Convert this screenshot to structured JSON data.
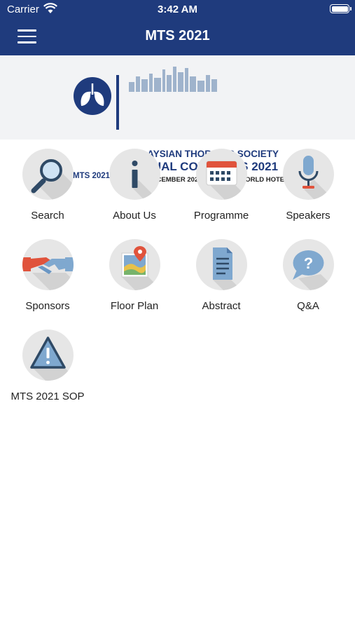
{
  "status_bar": {
    "carrier": "Carrier",
    "time": "3:42 AM"
  },
  "nav": {
    "title": "MTS 2021"
  },
  "banner": {
    "logo_text": "MTS 2021",
    "line1": "MALAYSIAN THORACIC SOCIETY",
    "line2": "ANNUAL CONGRESS 2021",
    "dates": "2-5 DECEMBER 2021",
    "venue": "ONE WORLD HOTEL"
  },
  "menu": [
    {
      "label": "Search",
      "icon": "search-icon"
    },
    {
      "label": "About Us",
      "icon": "info-icon"
    },
    {
      "label": "Programme",
      "icon": "calendar-icon"
    },
    {
      "label": "Speakers",
      "icon": "microphone-icon"
    },
    {
      "label": "Sponsors",
      "icon": "handshake-icon"
    },
    {
      "label": "Floor Plan",
      "icon": "map-pin-icon"
    },
    {
      "label": "Abstract",
      "icon": "document-icon"
    },
    {
      "label": "Q&A",
      "icon": "question-bubble-icon"
    },
    {
      "label": "MTS 2021 SOP",
      "icon": "warning-icon"
    }
  ],
  "colors": {
    "nav_bg": "#1f3b7d",
    "brand_blue": "#1f3b7d",
    "accent_red": "#e0533c",
    "icon_bg": "#e6e6e6"
  }
}
